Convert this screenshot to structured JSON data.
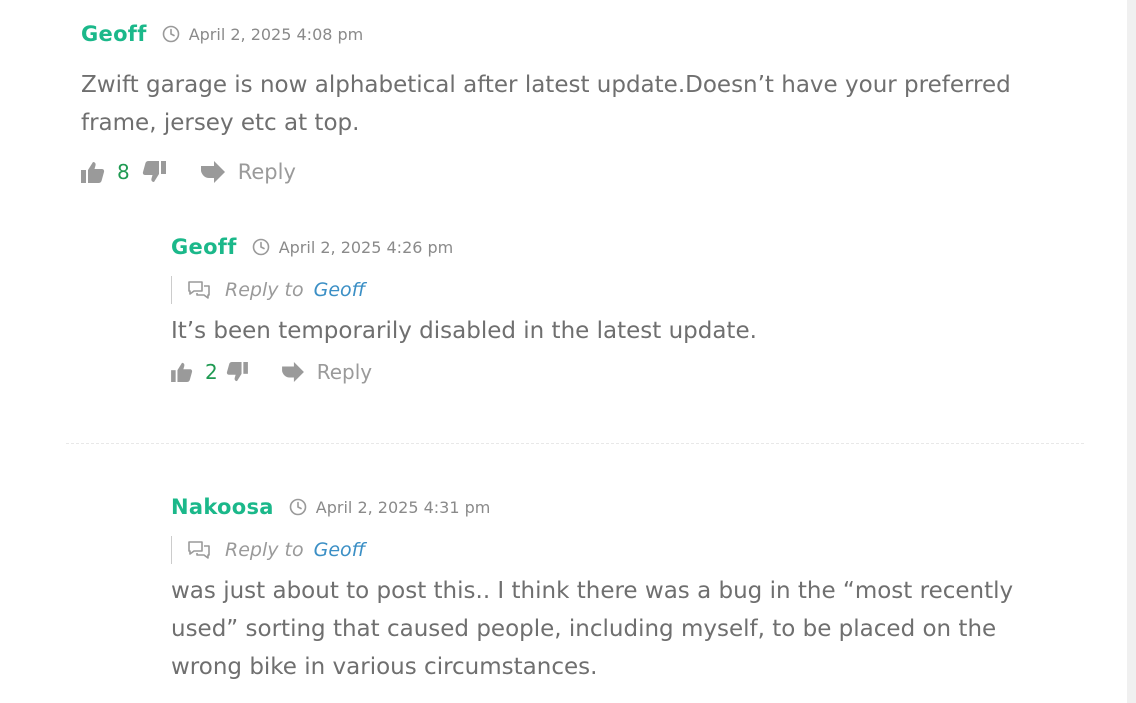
{
  "comments": [
    {
      "author": "Geoff",
      "date": "April 2, 2025 4:08 pm",
      "text": "Zwift garage is now alphabetical after latest update.Doesn’t have your preferred frame, jersey etc at top.",
      "likes": "8",
      "reply_label": "Reply"
    },
    {
      "author": "Geoff",
      "date": "April 2, 2025 4:26 pm",
      "reply_to_label": "Reply to",
      "reply_to_name": "Geoff",
      "text": "It’s been temporarily disabled in the latest update.",
      "likes": "2",
      "reply_label": "Reply"
    },
    {
      "author": "Nakoosa",
      "date": "April 2, 2025 4:31 pm",
      "reply_to_label": "Reply to",
      "reply_to_name": "Geoff",
      "text": "was just about to post this.. I think there was a bug in the “most recently used” sorting that caused people, including myself, to be placed on the wrong bike in various circumstances."
    }
  ],
  "icons": {
    "clock": "clock-icon",
    "thumbs_up": "thumbs-up-icon",
    "thumbs_down": "thumbs-down-icon",
    "reply_arrow": "reply-arrow-icon",
    "speech_bubbles": "speech-bubbles-icon"
  },
  "colors": {
    "author": "#1bb88a",
    "link": "#3b8fc5",
    "like_count": "#1f9a52",
    "text": "#6f6f6f",
    "muted": "#9a9a9a"
  }
}
